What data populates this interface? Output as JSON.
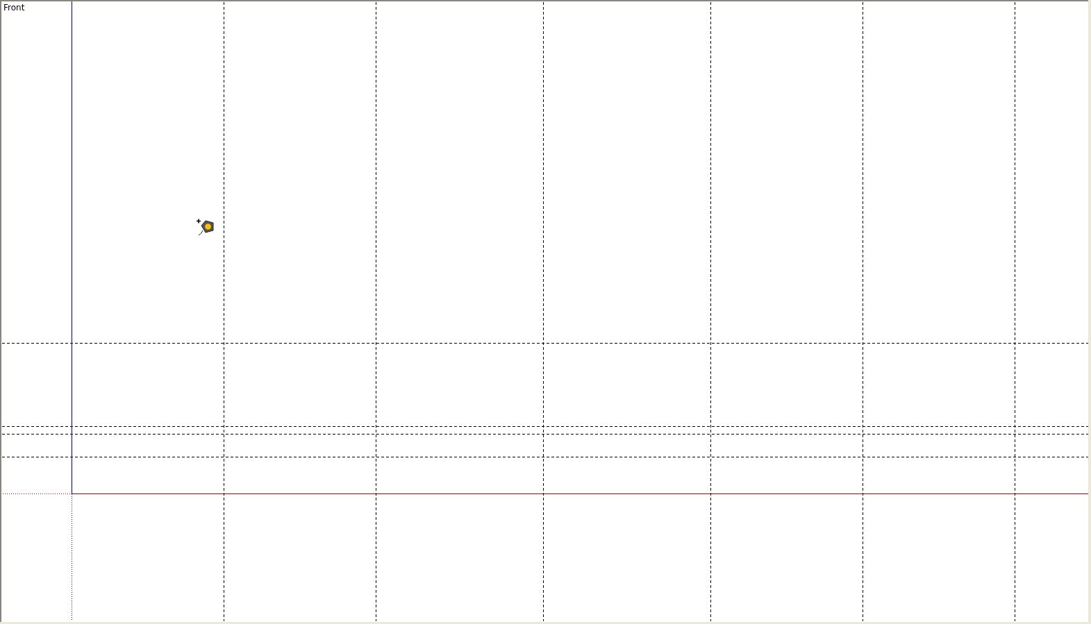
{
  "viewport": {
    "view_label": "Front"
  }
}
